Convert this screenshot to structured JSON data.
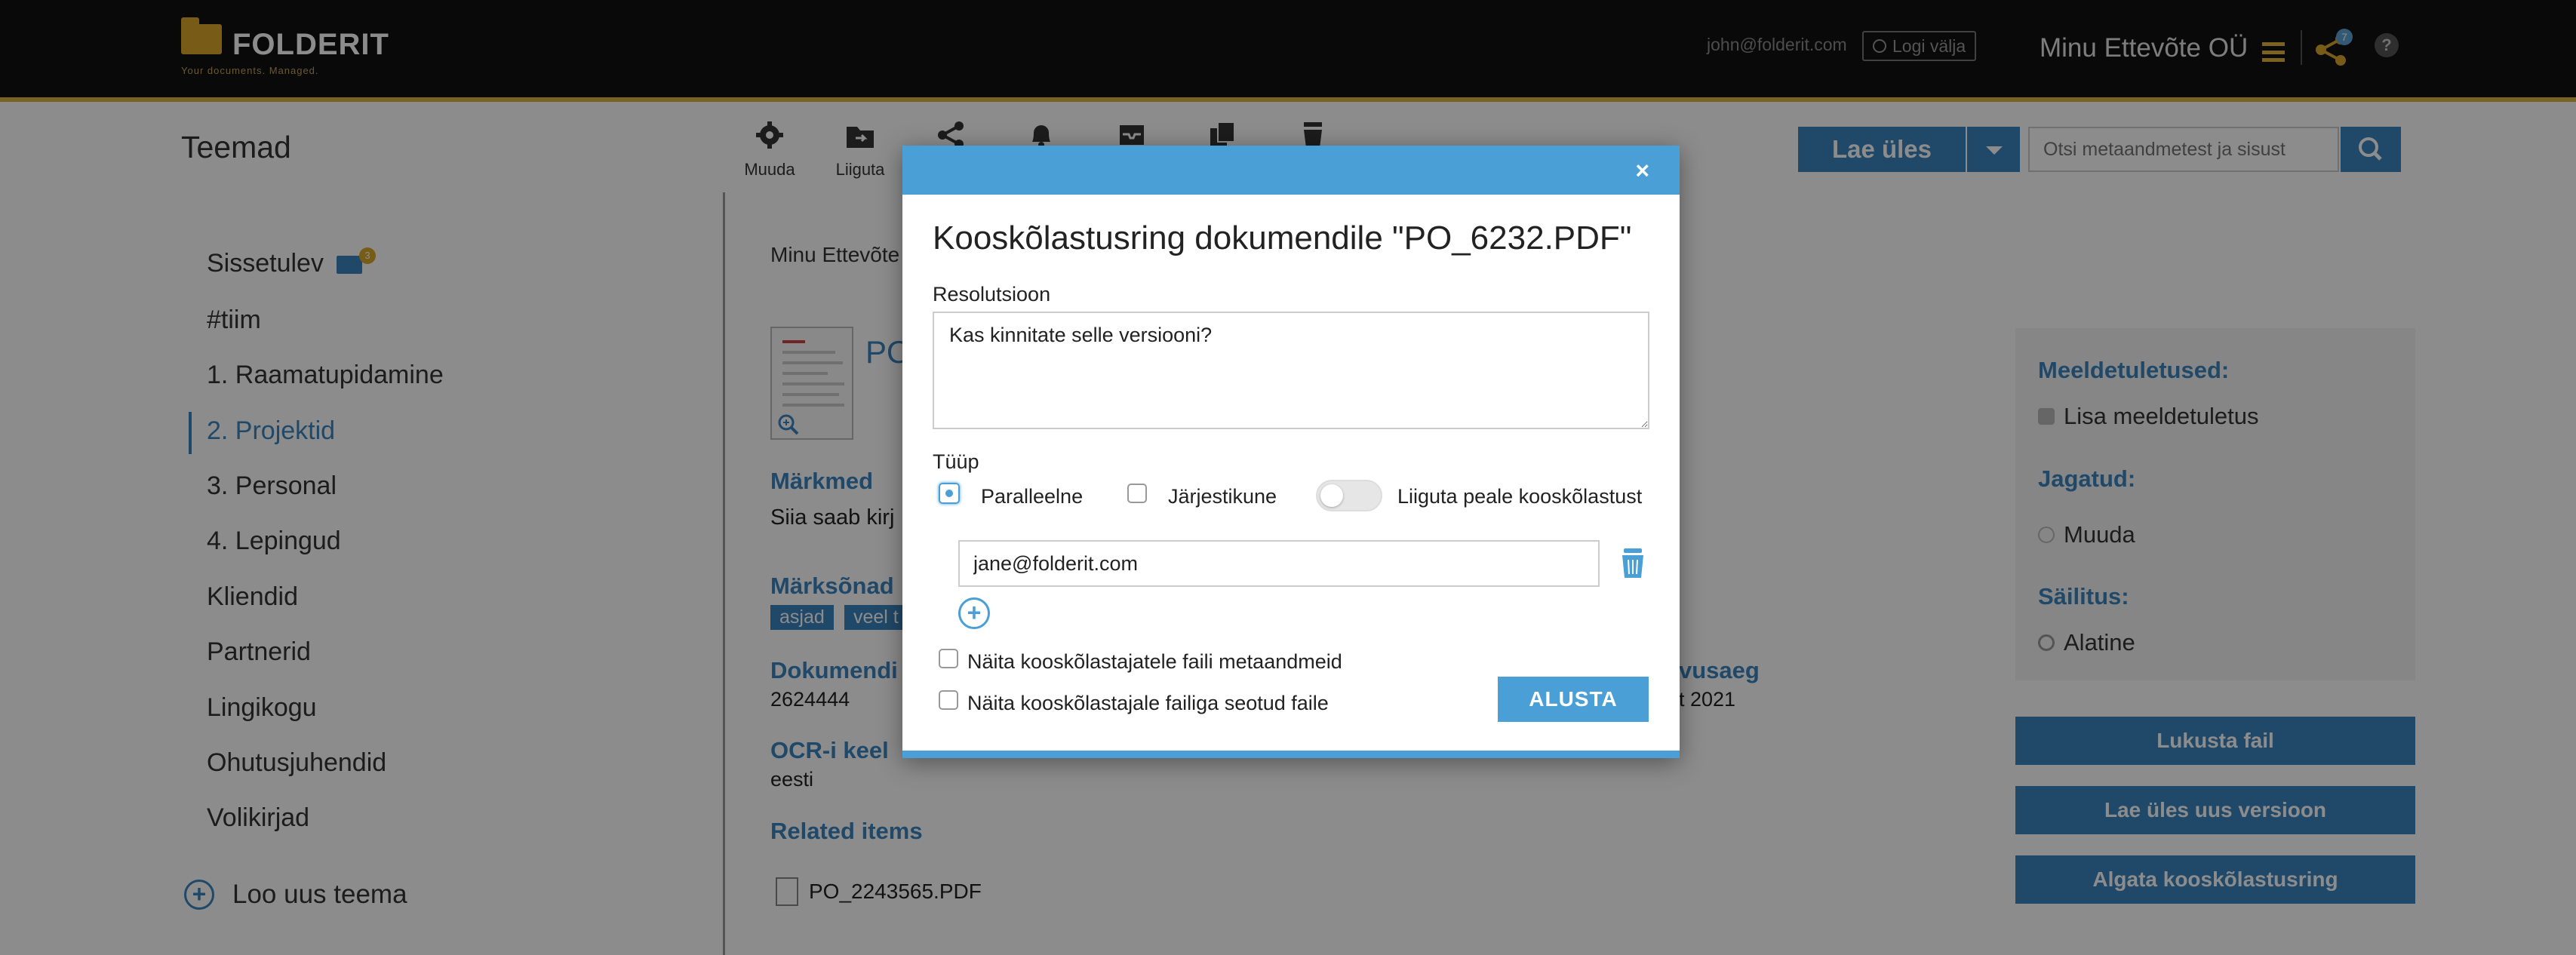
{
  "header": {
    "logo_name": "FOLDERIT",
    "logo_tagline": "Your documents. Managed.",
    "user_email": "john@folderit.com",
    "logout_label": "Logi välja",
    "company": "Minu Ettevõte OÜ",
    "share_badge": "7",
    "help_label": "?"
  },
  "toolbar": {
    "section_title": "Teemad",
    "tools": [
      {
        "label": "Muuda",
        "icon": "gear-icon"
      },
      {
        "label": "Liiguta",
        "icon": "folder-move-icon"
      },
      {
        "label": "",
        "icon": "share-icon"
      },
      {
        "label": "",
        "icon": "bell-icon"
      },
      {
        "label": "",
        "icon": "inbox-icon"
      },
      {
        "label": "",
        "icon": "copy-icon"
      },
      {
        "label": "",
        "icon": "trash-icon"
      }
    ],
    "upload_label": "Lae üles",
    "search_placeholder": "Otsi metaandmetest ja sisust"
  },
  "sidebar": {
    "items": [
      {
        "label": "Sissetulev",
        "badge": "3"
      },
      {
        "label": "#tiim"
      },
      {
        "label": "1. Raamatupidamine"
      },
      {
        "label": "2. Projektid",
        "active": true
      },
      {
        "label": "3. Personal"
      },
      {
        "label": "4. Lepingud"
      },
      {
        "label": "Kliendid"
      },
      {
        "label": "Partnerid"
      },
      {
        "label": "Lingikogu"
      },
      {
        "label": "Ohutusjuhendid"
      },
      {
        "label": "Volikirjad"
      }
    ],
    "new_theme_label": "Loo uus teema"
  },
  "main": {
    "breadcrumb": "Minu Ettevõte",
    "doc_title": "PO",
    "markmed_label": "Märkmed",
    "markmed_value": "Siia saab kirj",
    "keywords_label": "Märksõnad",
    "keywords": [
      "asjad",
      "veel t"
    ],
    "docnum_label": "Dokumendi",
    "docnum_value": "2624444",
    "year_label": "vusaeg",
    "year_value": "t 2021",
    "ocr_label": "OCR-i keel",
    "ocr_value": "eesti",
    "related_label": "Related items",
    "related_file": "PO_2243565.PDF"
  },
  "right_panel": {
    "reminders_label": "Meeldetuletused:",
    "add_reminder": "Lisa meeldetuletus",
    "shared_label": "Jagatud:",
    "shared_value": "Muuda",
    "retention_label": "Säilitus:",
    "retention_value": "Alatine",
    "lock_button": "Lukusta fail",
    "upload_version_button": "Lae üles uus versioon",
    "start_approval_button": "Algata kooskõlastusring"
  },
  "modal": {
    "close_label": "×",
    "title": "Kooskõlastusring dokumendile \"PO_6232.PDF\"",
    "resolution_label": "Resolutsioon",
    "resolution_value": "Kas kinnitate selle versiooni?",
    "type_label": "Tüüp",
    "option_parallel": "Paralleelne",
    "option_sequential": "Järjestikune",
    "toggle_label": "Liiguta peale kooskõlastust",
    "approver_email": "jane@folderit.com",
    "check_metadata": "Näita kooskõlastajatele faili metaandmeid",
    "check_related": "Näita kooskõlastajale failiga seotud faile",
    "start_button": "ALUSTA"
  },
  "colors": {
    "accent": "#3b86c0",
    "modal_header": "#4a9fd6",
    "brand_gold": "#d9a628",
    "topbar": "#111111"
  }
}
